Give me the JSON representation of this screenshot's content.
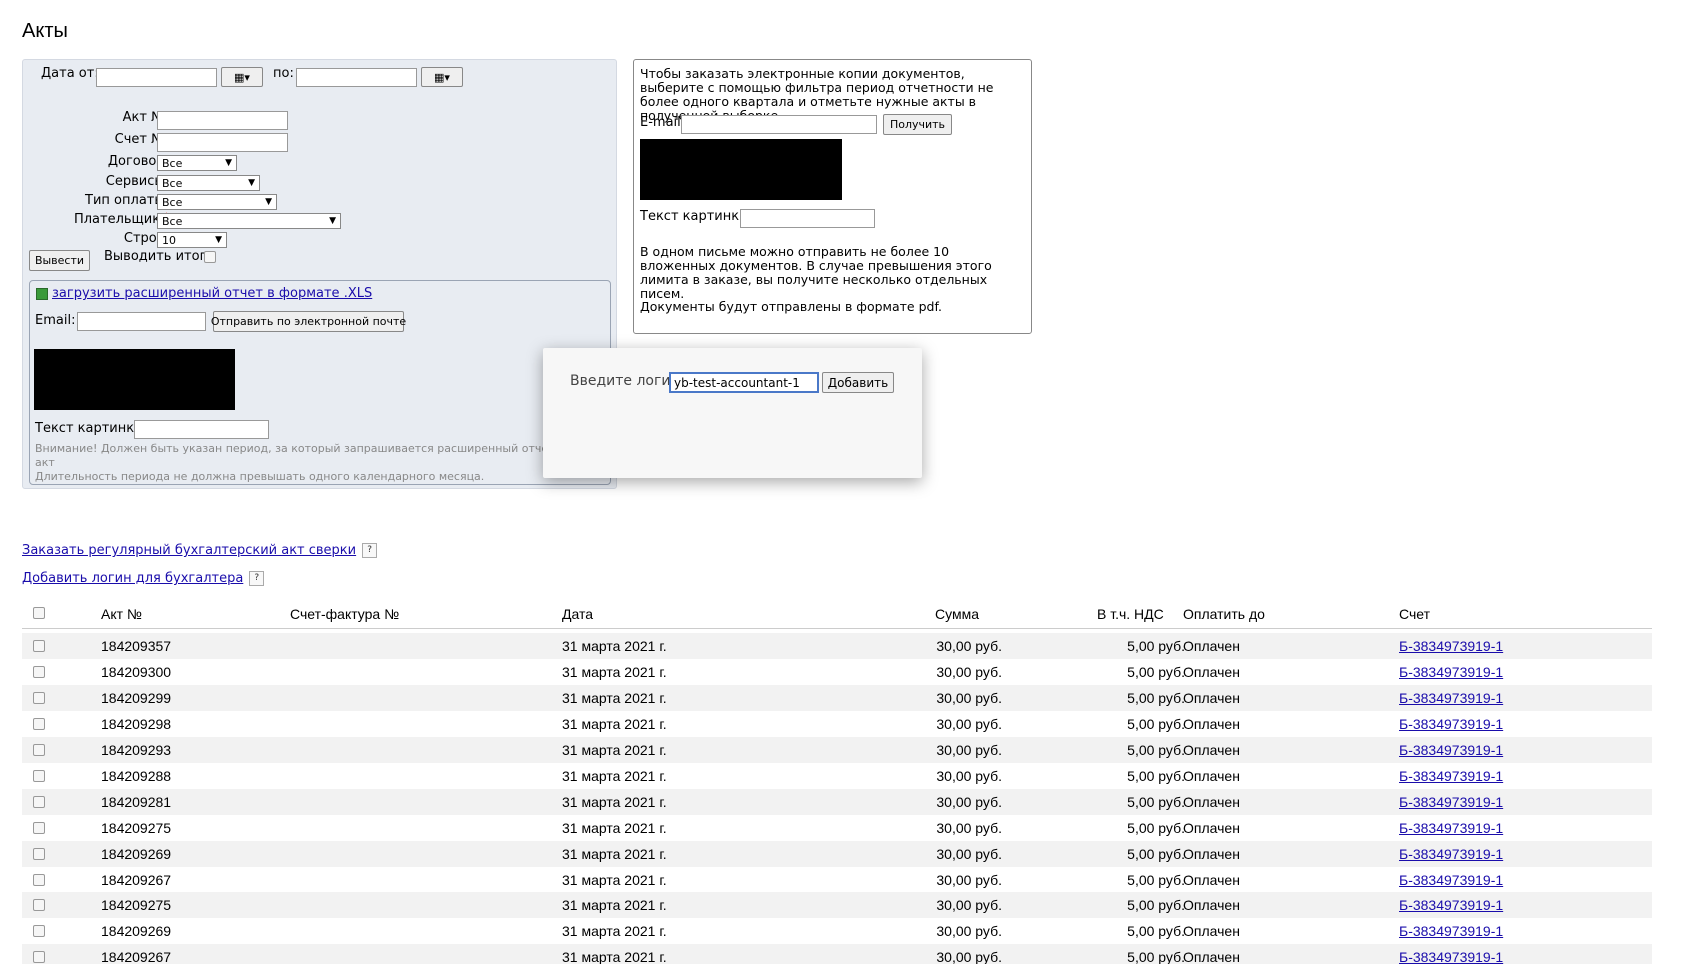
{
  "page": {
    "title": "Акты"
  },
  "filter": {
    "date_from_label": "Дата от:",
    "date_to_label": "по:",
    "act_label": "Акт №:",
    "invoice_label": "Счет №:",
    "contract_label": "Договор:",
    "contract_value": "Все",
    "services_label": "Сервисы:",
    "services_value": "Все",
    "payment_type_label": "Тип оплаты:",
    "payment_type_value": "Все",
    "payer_label": "Плательщик:",
    "payer_required_mark": "*",
    "payer_value": "Все",
    "rows_label": "Строк:",
    "rows_value": "10",
    "show_button": "Вывести",
    "show_totals_label": "Выводить итоги"
  },
  "report": {
    "xls_link": "загрузить расширенный отчет в формате .XLS",
    "email_label": "Email:",
    "send_button": "Отправить по электронной почте",
    "captcha_label": "Текст картинки:",
    "note_line1": "Внимание! Должен быть указан период, за который запрашивается расширенный отчет по акт",
    "note_line2": "Длительность периода не должна превышать одного календарного месяца."
  },
  "order": {
    "instructions": "Чтобы заказать электронные копии документов, выберите с помощью фильтра период отчетности не более одного квартала и отметьте нужные акты в полученной выборке.",
    "email_label": "E-mail:",
    "get_button": "Получить",
    "captcha_label": "Текст картинки:",
    "limit_note": "В одном письме можно отправить не более 10 вложенных документов. В случае превышения этого лимита в заказе, вы получите несколько отдельных писем.",
    "format_note": "Документы будут отправлены в формате pdf."
  },
  "dialog": {
    "prompt": "Введите логин",
    "input_value": "yb-test-accountant-1",
    "add_button": "Добавить"
  },
  "links": {
    "reconciliation": "Заказать регулярный бухгалтерский акт сверки",
    "add_login": "Добавить логин для бухгалтера"
  },
  "table": {
    "columns": [
      "Акт №",
      "Счет-фактура №",
      "Дата",
      "Сумма",
      "В т.ч. НДС",
      "Оплатить до",
      "Счет"
    ],
    "rows": [
      {
        "act": "184209357",
        "date": "31 марта 2021 г.",
        "sum": "30,00 руб.",
        "vat": "5,00 руб.",
        "status": "Оплачен",
        "invoice": "Б-3834973919-1"
      },
      {
        "act": "184209300",
        "date": "31 марта 2021 г.",
        "sum": "30,00 руб.",
        "vat": "5,00 руб.",
        "status": "Оплачен",
        "invoice": "Б-3834973919-1"
      },
      {
        "act": "184209299",
        "date": "31 марта 2021 г.",
        "sum": "30,00 руб.",
        "vat": "5,00 руб.",
        "status": "Оплачен",
        "invoice": "Б-3834973919-1"
      },
      {
        "act": "184209298",
        "date": "31 марта 2021 г.",
        "sum": "30,00 руб.",
        "vat": "5,00 руб.",
        "status": "Оплачен",
        "invoice": "Б-3834973919-1"
      },
      {
        "act": "184209293",
        "date": "31 марта 2021 г.",
        "sum": "30,00 руб.",
        "vat": "5,00 руб.",
        "status": "Оплачен",
        "invoice": "Б-3834973919-1"
      },
      {
        "act": "184209288",
        "date": "31 марта 2021 г.",
        "sum": "30,00 руб.",
        "vat": "5,00 руб.",
        "status": "Оплачен",
        "invoice": "Б-3834973919-1"
      },
      {
        "act": "184209281",
        "date": "31 марта 2021 г.",
        "sum": "30,00 руб.",
        "vat": "5,00 руб.",
        "status": "Оплачен",
        "invoice": "Б-3834973919-1"
      },
      {
        "act": "184209275",
        "date": "31 марта 2021 г.",
        "sum": "30,00 руб.",
        "vat": "5,00 руб.",
        "status": "Оплачен",
        "invoice": "Б-3834973919-1"
      },
      {
        "act": "184209269",
        "date": "31 марта 2021 г.",
        "sum": "30,00 руб.",
        "vat": "5,00 руб.",
        "status": "Оплачен",
        "invoice": "Б-3834973919-1"
      },
      {
        "act": "184209267",
        "date": "31 марта 2021 г.",
        "sum": "30,00 руб.",
        "vat": "5,00 руб.",
        "status": "Оплачен",
        "invoice": "Б-3834973919-1"
      },
      {
        "act": "184209275",
        "date": "31 марта 2021 г.",
        "sum": "30,00 руб.",
        "vat": "5,00 руб.",
        "status": "Оплачен",
        "invoice": "Б-3834973919-1"
      },
      {
        "act": "184209269",
        "date": "31 марта 2021 г.",
        "sum": "30,00 руб.",
        "vat": "5,00 руб.",
        "status": "Оплачен",
        "invoice": "Б-3834973919-1"
      },
      {
        "act": "184209267",
        "date": "31 марта 2021 г.",
        "sum": "30,00 руб.",
        "vat": "5,00 руб.",
        "status": "Оплачен",
        "invoice": "Б-3834973919-1"
      }
    ]
  }
}
